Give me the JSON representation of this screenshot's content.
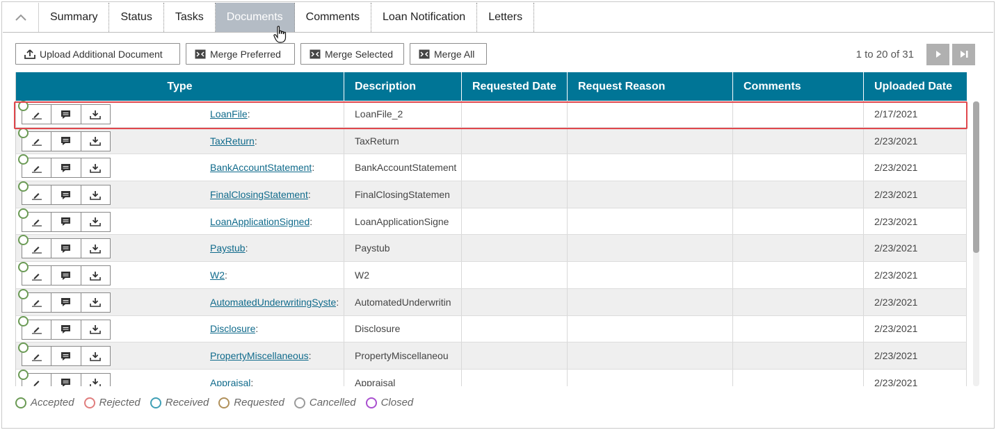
{
  "tabs": [
    {
      "label": "Summary",
      "active": false
    },
    {
      "label": "Status",
      "active": false
    },
    {
      "label": "Tasks",
      "active": false
    },
    {
      "label": "Documents",
      "active": true
    },
    {
      "label": "Comments",
      "active": false
    },
    {
      "label": "Loan Notification",
      "active": false
    },
    {
      "label": "Letters",
      "active": false
    }
  ],
  "toolbar": {
    "upload_label": "Upload Additional Document",
    "merge_preferred_label": "Merge Preferred",
    "merge_selected_label": "Merge Selected",
    "merge_all_label": "Merge All"
  },
  "pager": {
    "text": "1 to 20 of 31"
  },
  "table": {
    "headers": {
      "type": "Type",
      "description": "Description",
      "requested_date": "Requested Date",
      "request_reason": "Request Reason",
      "comments": "Comments",
      "uploaded_date": "Uploaded Date"
    },
    "rows": [
      {
        "type": "LoanFile",
        "description": "LoanFile_2",
        "requested_date": "",
        "request_reason": "",
        "comments": "",
        "uploaded_date": "2/17/2021"
      },
      {
        "type": "TaxReturn",
        "description": "TaxReturn",
        "requested_date": "",
        "request_reason": "",
        "comments": "",
        "uploaded_date": "2/23/2021"
      },
      {
        "type": "BankAccountStatement",
        "description": "BankAccountStatement",
        "requested_date": "",
        "request_reason": "",
        "comments": "",
        "uploaded_date": "2/23/2021"
      },
      {
        "type": "FinalClosingStatement",
        "description": "FinalClosingStatemen",
        "requested_date": "",
        "request_reason": "",
        "comments": "",
        "uploaded_date": "2/23/2021"
      },
      {
        "type": "LoanApplicationSigned",
        "description": "LoanApplicationSigne",
        "requested_date": "",
        "request_reason": "",
        "comments": "",
        "uploaded_date": "2/23/2021"
      },
      {
        "type": "Paystub",
        "description": "Paystub",
        "requested_date": "",
        "request_reason": "",
        "comments": "",
        "uploaded_date": "2/23/2021"
      },
      {
        "type": "W2",
        "description": "W2",
        "requested_date": "",
        "request_reason": "",
        "comments": "",
        "uploaded_date": "2/23/2021"
      },
      {
        "type": "AutomatedUnderwritingSyste",
        "description": "AutomatedUnderwritin",
        "requested_date": "",
        "request_reason": "",
        "comments": "",
        "uploaded_date": "2/23/2021"
      },
      {
        "type": "Disclosure",
        "description": "Disclosure",
        "requested_date": "",
        "request_reason": "",
        "comments": "",
        "uploaded_date": "2/23/2021"
      },
      {
        "type": "PropertyMiscellaneous",
        "description": "PropertyMiscellaneou",
        "requested_date": "",
        "request_reason": "",
        "comments": "",
        "uploaded_date": "2/23/2021"
      },
      {
        "type": "Appraisal",
        "description": "Appraisal",
        "requested_date": "",
        "request_reason": "",
        "comments": "",
        "uploaded_date": "2/23/2021"
      }
    ]
  },
  "legend": [
    {
      "label": "Accepted",
      "color": "#6a9a54"
    },
    {
      "label": "Rejected",
      "color": "#e07d7d"
    },
    {
      "label": "Received",
      "color": "#3f9fb5"
    },
    {
      "label": "Requested",
      "color": "#b0905a"
    },
    {
      "label": "Cancelled",
      "color": "#9a9a9a"
    },
    {
      "label": "Closed",
      "color": "#a94fcf"
    }
  ],
  "colors": {
    "header_bg": "#007596",
    "active_tab": "#b4bcc5",
    "highlight": "#e0474c",
    "link": "#0f6a8b"
  },
  "icons": [
    "chevron-up-icon",
    "upload-icon",
    "merge-icon",
    "edit-icon",
    "comment-icon",
    "download-icon",
    "next-page-icon",
    "last-page-icon",
    "hand-cursor-icon"
  ]
}
